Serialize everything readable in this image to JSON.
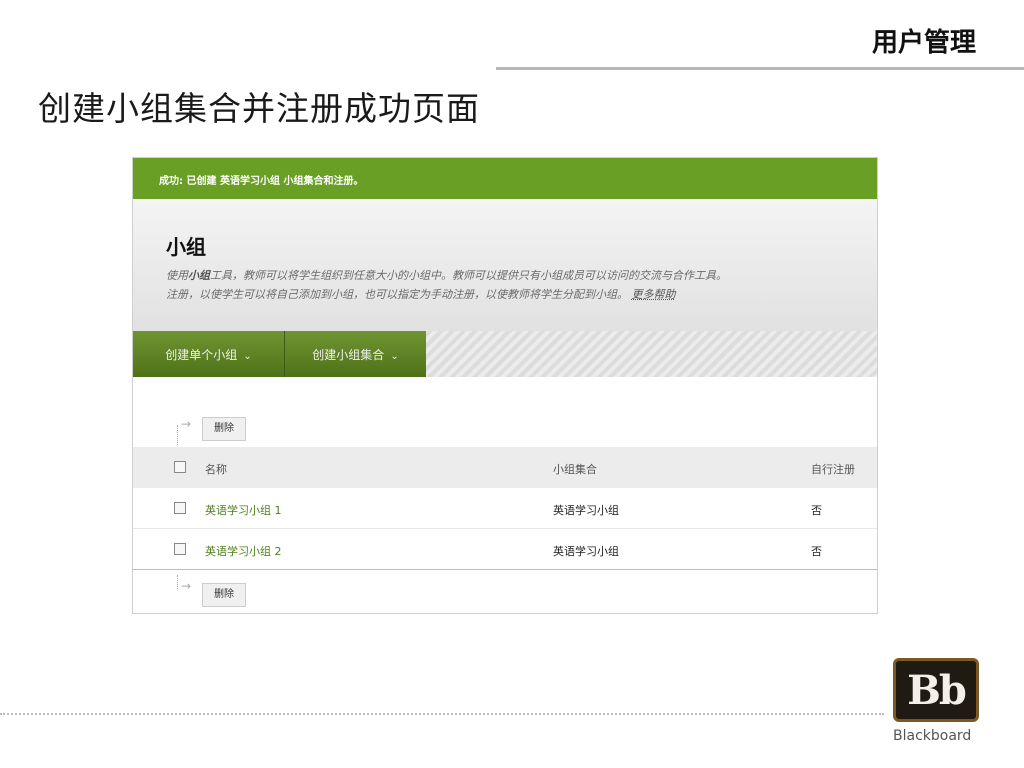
{
  "slide": {
    "header": "用户管理",
    "title": "创建小组集合并注册成功页面"
  },
  "screenshot": {
    "success_message": "成功: 已创建 英语学习小组 小组集合和注册。",
    "page_title": "小组",
    "description_line1_pre": "使用",
    "description_line1_bold": "小组",
    "description_line1_post": "工具，教师可以将学生组织到任意大小的小组中。教师可以提供只有小组成员可以访问的交流与合作工具。",
    "description_line2": "注册，以使学生可以将自己添加到小组，也可以指定为手动注册，以使教师将学生分配到小组。",
    "more_help": "更多帮助",
    "action_buttons": [
      {
        "label": "创建单个小组"
      },
      {
        "label": "创建小组集合"
      }
    ],
    "delete_label": "删除",
    "table": {
      "headers": [
        "名称",
        "小组集合",
        "自行注册"
      ],
      "rows": [
        [
          "英语学习小组 1",
          "英语学习小组",
          "否"
        ],
        [
          "英语学习小组 2",
          "英语学习小组",
          "否"
        ]
      ]
    }
  },
  "logo": {
    "mark": "Bb",
    "wordmark": "Blackboard"
  },
  "colors": {
    "success_green": "#6a9f25",
    "action_green": "#5e8224",
    "link_green": "#4f7f1a"
  }
}
